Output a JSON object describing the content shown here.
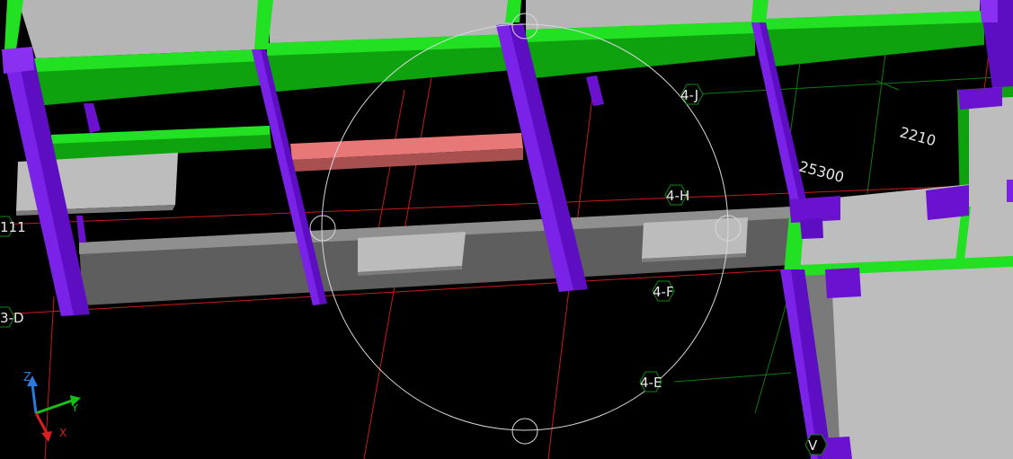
{
  "viewport": {
    "grid_labels": {
      "l4j": "4-J",
      "l4h": "4-H",
      "l4f": "4-F",
      "l4e": "4-E",
      "l111": "111",
      "l3d": "3-D",
      "lv": "V"
    },
    "dimensions": {
      "d2210": "2210",
      "d25300": "25300"
    },
    "axes": {
      "z": "Z",
      "y": "Y",
      "x": "X"
    }
  },
  "colors": {
    "background": "#000000",
    "column": "#6a12d0",
    "beam_green": "#12cc12",
    "beam_red": "#e07070",
    "slab_gray": "#b8b8b8",
    "grid_red": "#d01818",
    "grid_green": "#0e7a0e",
    "orbit_circle": "#d8d8d8"
  }
}
